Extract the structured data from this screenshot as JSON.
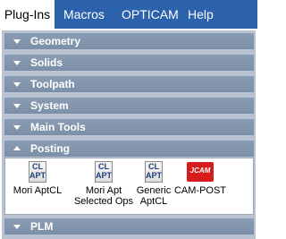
{
  "menubar": {
    "items": [
      "Plug-Ins",
      "Macros",
      "OPTICAM",
      "Help"
    ],
    "active": "Plug-Ins",
    "color": "#2b62ab"
  },
  "sections": [
    {
      "label": "Geometry",
      "expanded": false
    },
    {
      "label": "Solids",
      "expanded": false
    },
    {
      "label": "Toolpath",
      "expanded": false
    },
    {
      "label": "System",
      "expanded": false
    },
    {
      "label": "Main Tools",
      "expanded": false
    },
    {
      "label": "Posting",
      "expanded": true
    },
    {
      "label": "PLM",
      "expanded": false
    }
  ],
  "posting_tools": [
    {
      "icon": "cl-apt-icon",
      "icon_text": [
        "CL",
        "APT"
      ],
      "label_lines": [
        "Mori AptCL",
        ""
      ]
    },
    {
      "icon": "cl-apt-icon",
      "icon_text": [
        "CL",
        "APT"
      ],
      "label_lines": [
        "Mori Apt",
        "Selected Ops"
      ]
    },
    {
      "icon": "cl-apt-icon",
      "icon_text": [
        "CL",
        "APT"
      ],
      "label_lines": [
        "Generic",
        "AptCL"
      ]
    },
    {
      "icon": "jcam-icon",
      "icon_text": [
        "JCAM"
      ],
      "label_lines": [
        "CAM-POST",
        ""
      ]
    }
  ]
}
